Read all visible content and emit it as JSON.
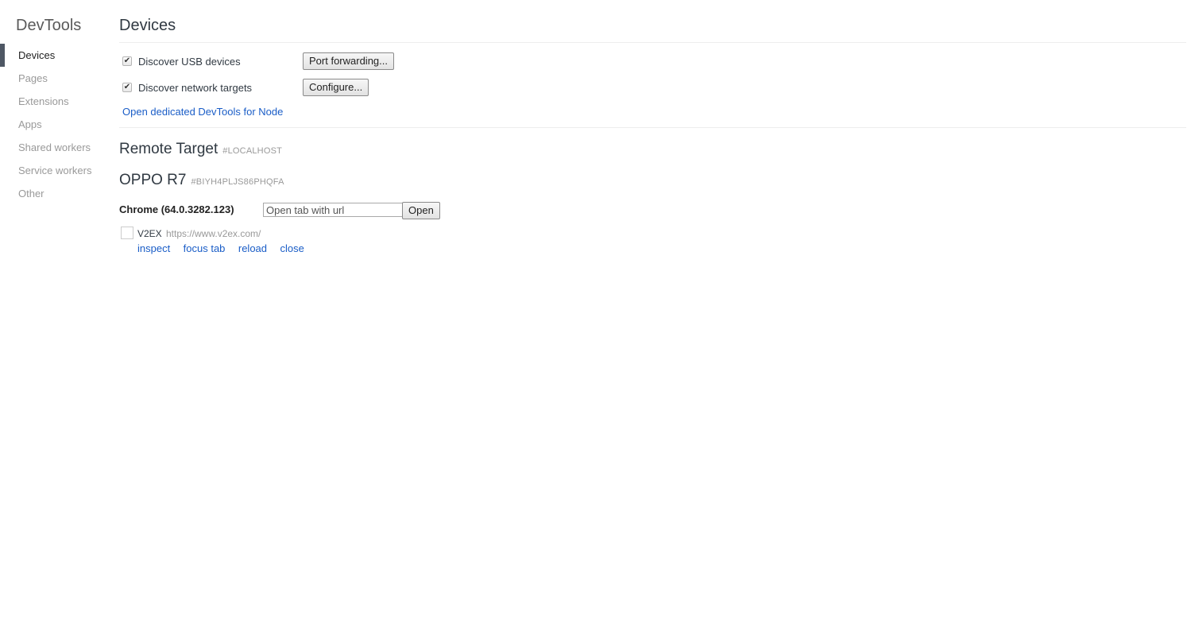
{
  "sidebar": {
    "title": "DevTools",
    "items": [
      {
        "label": "Devices",
        "selected": true
      },
      {
        "label": "Pages"
      },
      {
        "label": "Extensions"
      },
      {
        "label": "Apps"
      },
      {
        "label": "Shared workers"
      },
      {
        "label": "Service workers"
      },
      {
        "label": "Other"
      }
    ]
  },
  "main": {
    "title": "Devices",
    "options": [
      {
        "label": "Discover USB devices",
        "checked": true,
        "button": "Port forwarding..."
      },
      {
        "label": "Discover network targets",
        "checked": true,
        "button": "Configure..."
      }
    ],
    "node_link": "Open dedicated DevTools for Node",
    "remote": {
      "title": "Remote Target",
      "subtitle": "#LOCALHOST"
    },
    "device": {
      "name": "OPPO R7",
      "serial": "#BIYH4PLJS86PHQFA",
      "browser": "Chrome (64.0.3282.123)",
      "open_placeholder": "Open tab with url",
      "open_button": "Open",
      "targets": [
        {
          "name": "V2EX",
          "url": "https://www.v2ex.com/",
          "actions": [
            "inspect",
            "focus tab",
            "reload",
            "close"
          ]
        }
      ]
    }
  },
  "colors": {
    "link": "#1a5dc7",
    "selected_bar": "#4e5764",
    "muted_text": "#999999",
    "divider": "#eeeeee"
  }
}
